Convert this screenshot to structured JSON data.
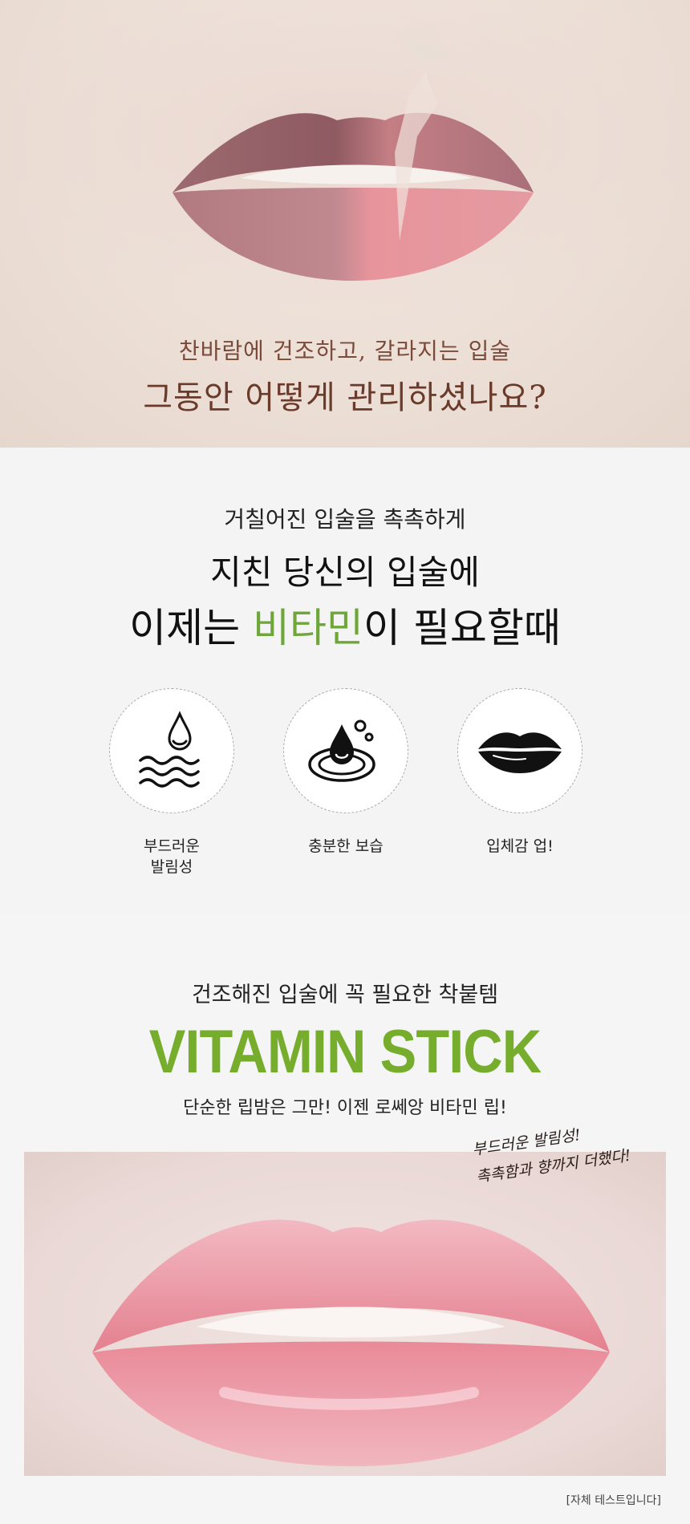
{
  "intro": {
    "subtitle": "찬바람에 건조하고, 갈라지는 입술",
    "headline": "그동안 어떻게 관리하셨나요?"
  },
  "need": {
    "line1": "거칠어진 입술을 촉촉하게",
    "line2": "지친 당신의 입술에",
    "line3_before": "이제는 ",
    "line3_highlight": "비타민",
    "line3_after": "이 필요할때",
    "highlight_color": "#6ea63a",
    "features": [
      {
        "icon": "water-drop-waves-icon",
        "label_line1": "부드러운",
        "label_line2": "발림성"
      },
      {
        "icon": "drop-splash-icon",
        "label_line1": "충분한 보습",
        "label_line2": ""
      },
      {
        "icon": "lips-icon",
        "label_line1": "입체감 업!",
        "label_line2": ""
      }
    ]
  },
  "product": {
    "pre_title": "건조해진 입술에 꼭 필요한 착붙템",
    "title": "VITAMIN STICK",
    "title_color": "#76ad2c",
    "tagline": "단순한 립밤은 그만! 이젠 로쎄앙 비타민 립!",
    "handwritten_line1": "부드러운 발림성!",
    "handwritten_line2": "촉촉함과 향까지 더했다!",
    "test_note": "[자체 테스트입니다]"
  }
}
